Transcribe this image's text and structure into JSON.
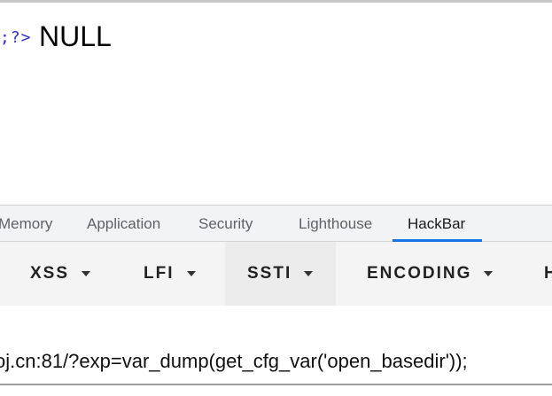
{
  "page": {
    "code_tail": ";?>",
    "output": "NULL"
  },
  "devtools": {
    "tabs": [
      {
        "label": "Memory"
      },
      {
        "label": "Application"
      },
      {
        "label": "Security"
      },
      {
        "label": "Lighthouse"
      },
      {
        "label": "HackBar",
        "active": true
      }
    ],
    "accent_color": "#1a73e8"
  },
  "hackbar": {
    "menu": [
      {
        "label": "XSS",
        "icon": "caret-down-icon"
      },
      {
        "label": "LFI",
        "icon": "caret-down-icon"
      },
      {
        "label": "SSTI",
        "icon": "caret-down-icon"
      },
      {
        "label": "ENCODING",
        "icon": "caret-down-icon"
      },
      {
        "label": "H"
      }
    ],
    "url_value": "oj.cn:81/?exp=var_dump(get_cfg_var('open_basedir'));"
  }
}
